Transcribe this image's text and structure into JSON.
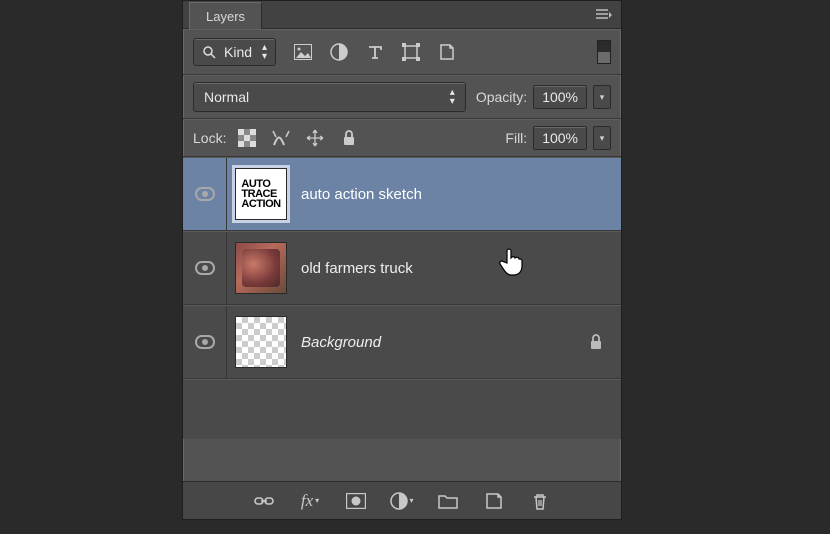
{
  "panel": {
    "title": "Layers"
  },
  "filter": {
    "kind_label": "Kind"
  },
  "blend": {
    "mode": "Normal",
    "opacity_label": "Opacity:",
    "opacity_value": "100%"
  },
  "lock": {
    "label": "Lock:",
    "fill_label": "Fill:",
    "fill_value": "100%"
  },
  "layers": [
    {
      "name": "auto action sketch",
      "selected": true,
      "locked": false,
      "thumb": "auto-trace"
    },
    {
      "name": "old farmers truck",
      "selected": false,
      "locked": false,
      "thumb": "truck"
    },
    {
      "name": "Background",
      "selected": false,
      "locked": true,
      "thumb": "checker",
      "italic": true
    }
  ],
  "thumb_text": {
    "l1": "auto",
    "l2": "trace",
    "l3": "action"
  }
}
